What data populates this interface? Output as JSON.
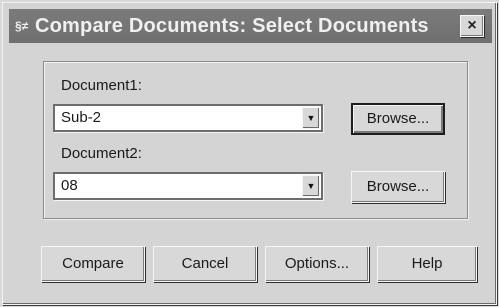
{
  "window": {
    "title": "Compare Documents: Select Documents",
    "title_icon": "document-compare-icon",
    "close_label": "×"
  },
  "document1": {
    "label": "Document1:",
    "value": "Sub-2",
    "browse_label": "Browse..."
  },
  "document2": {
    "label": "Document2:",
    "value": "08",
    "browse_label": "Browse..."
  },
  "buttons": {
    "compare": "Compare",
    "cancel": "Cancel",
    "options": "Options...",
    "help": "Help"
  },
  "combo_arrow_glyph": "▼",
  "title_icon_glyph": "§≠"
}
